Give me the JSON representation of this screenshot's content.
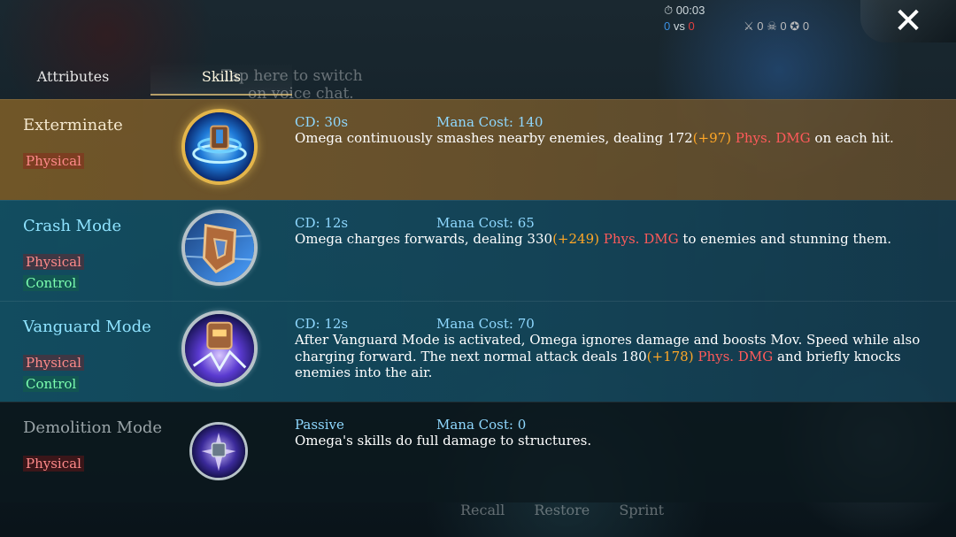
{
  "hud": {
    "timer": "00:03",
    "blue_kills": "0",
    "vs": "vs",
    "red_kills": "0",
    "kills": "0",
    "deaths": "0",
    "assists": "0",
    "close_label": "✕"
  },
  "tabs": {
    "attributes": "Attributes",
    "skills": "Skills",
    "hint_line1": "Tap here to switch",
    "hint_line2": "on voice chat."
  },
  "skills": [
    {
      "name": "Exterminate",
      "tags": [
        "Physical"
      ],
      "cd": "CD: 30s",
      "mana": "Mana Cost: 140",
      "desc_a": "Omega continuously smashes nearby enemies, dealing 172",
      "bonus": "(+97)",
      "dmg": " Phys. DMG",
      "desc_b": " on each hit."
    },
    {
      "name": "Crash Mode",
      "tags": [
        "Physical",
        "Control"
      ],
      "cd": "CD: 12s",
      "mana": "Mana Cost: 65",
      "desc_a": "Omega charges forwards, dealing 330",
      "bonus": "(+249)",
      "dmg": " Phys. DMG",
      "desc_b": " to enemies and stunning them."
    },
    {
      "name": "Vanguard Mode",
      "tags": [
        "Physical",
        "Control"
      ],
      "cd": "CD: 12s",
      "mana": "Mana Cost: 70",
      "desc_a": "After Vanguard Mode is activated, Omega ignores damage and boosts Mov. Speed while also charging forward. The next normal attack deals 180",
      "bonus": "(+178)",
      "dmg": " Phys. DMG",
      "desc_b": " and briefly knocks enemies into the air."
    },
    {
      "name": "Demolition Mode",
      "tags": [
        "Physical"
      ],
      "cd": "Passive",
      "mana": "Mana Cost: 0",
      "desc_a": "Omega's skills do full damage to structures.",
      "bonus": "",
      "dmg": "",
      "desc_b": ""
    }
  ],
  "bottom": {
    "recall": "Recall",
    "restore": "Restore",
    "sprint": "Sprint"
  }
}
